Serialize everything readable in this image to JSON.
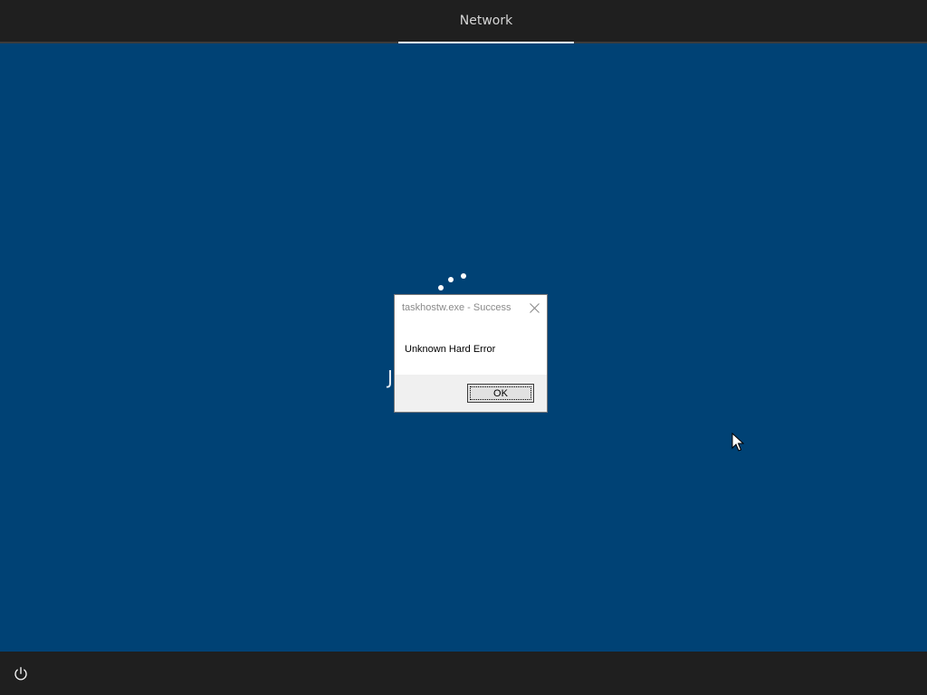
{
  "top_bar": {
    "tab_label": "Network"
  },
  "background": {
    "color": "#004275",
    "username_fragment": "J"
  },
  "dialog": {
    "title": "taskhostw.exe - Success",
    "message": "Unknown Hard Error",
    "ok_label": "OK",
    "close_icon": "close-icon"
  },
  "bottom_bar": {
    "power_icon": "power-icon"
  },
  "colors": {
    "lock_screen_blue": "#004275",
    "bar_dark": "#1f1f1f"
  }
}
